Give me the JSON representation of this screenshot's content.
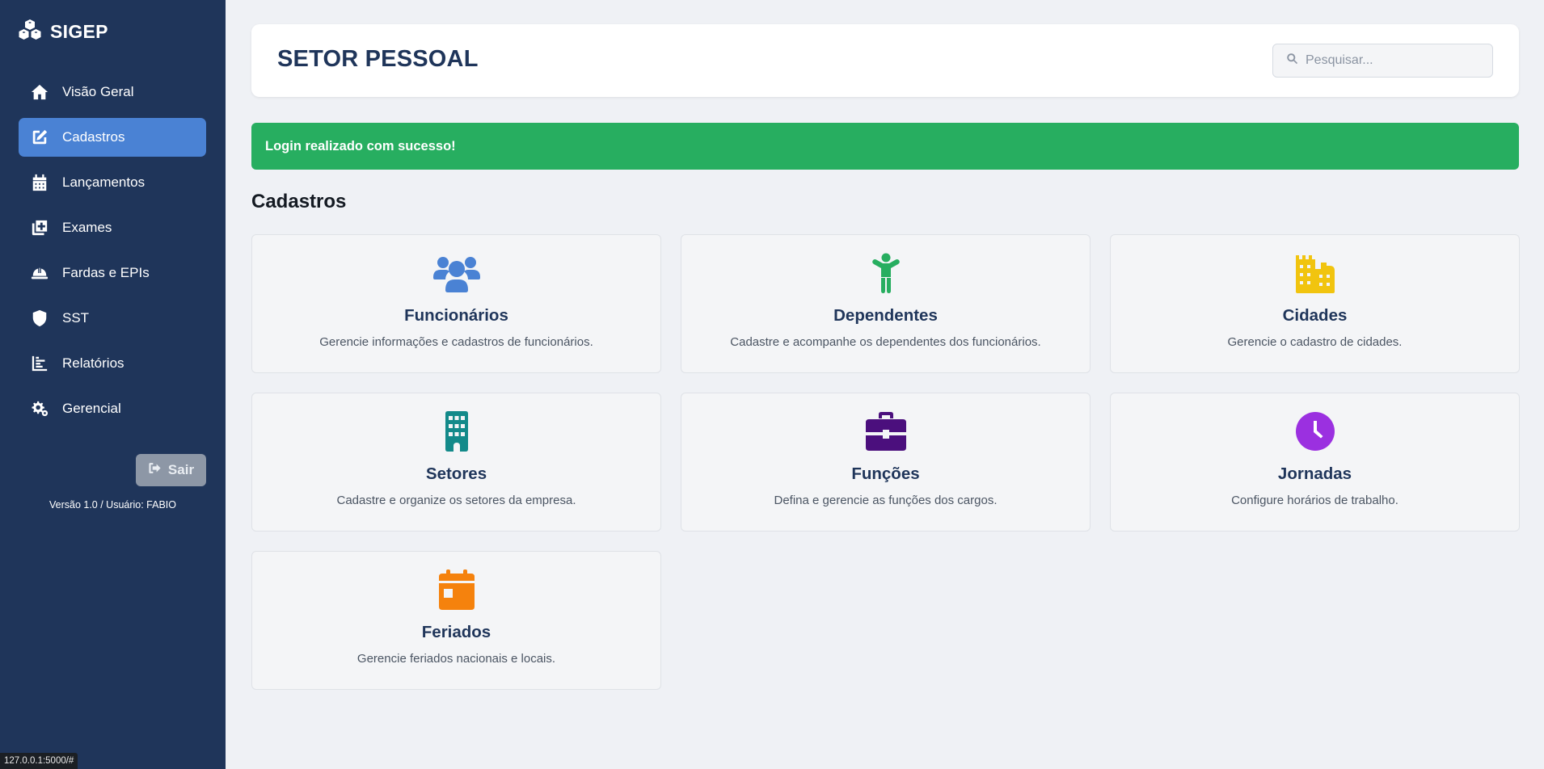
{
  "app": {
    "name": "SIGEP"
  },
  "sidebar": {
    "items": [
      {
        "label": "Visão Geral",
        "icon": "home-icon",
        "active": false
      },
      {
        "label": "Cadastros",
        "icon": "edit-icon",
        "active": true
      },
      {
        "label": "Lançamentos",
        "icon": "calendar-icon",
        "active": false
      },
      {
        "label": "Exames",
        "icon": "medical-icon",
        "active": false
      },
      {
        "label": "Fardas e EPIs",
        "icon": "hard-hat-icon",
        "active": false
      },
      {
        "label": "SST",
        "icon": "shield-icon",
        "active": false
      },
      {
        "label": "Relatórios",
        "icon": "chart-icon",
        "active": false
      },
      {
        "label": "Gerencial",
        "icon": "gears-icon",
        "active": false
      }
    ],
    "logout_label": "Sair",
    "version_text": "Versão 1.0 / Usuário: FABIO"
  },
  "header": {
    "title": "SETOR PESSOAL",
    "search_placeholder": "Pesquisar..."
  },
  "alert": {
    "message": "Login realizado com sucesso!",
    "color": "#27ae60"
  },
  "section": {
    "title": "Cadastros"
  },
  "cards": [
    {
      "title": "Funcionários",
      "description": "Gerencie informações e cadastros de funcionários.",
      "icon": "users-icon",
      "color": "#4a82d4"
    },
    {
      "title": "Dependentes",
      "description": "Cadastre e acompanhe os dependentes dos funcionários.",
      "icon": "child-icon",
      "color": "#27ae60"
    },
    {
      "title": "Cidades",
      "description": "Gerencie o cadastro de cidades.",
      "icon": "city-icon",
      "color": "#f1c40f"
    },
    {
      "title": "Setores",
      "description": "Cadastre e organize os setores da empresa.",
      "icon": "building-icon",
      "color": "#138a8a"
    },
    {
      "title": "Funções",
      "description": "Defina e gerencie as funções dos cargos.",
      "icon": "briefcase-icon",
      "color": "#4b0f7d"
    },
    {
      "title": "Jornadas",
      "description": "Configure horários de trabalho.",
      "icon": "clock-icon",
      "color": "#9b30e0"
    },
    {
      "title": "Feriados",
      "description": "Gerencie feriados nacionais e locais.",
      "icon": "calendar-day-icon",
      "color": "#f5820d"
    }
  ],
  "status_bar": {
    "url": "127.0.0.1:5000/#"
  }
}
